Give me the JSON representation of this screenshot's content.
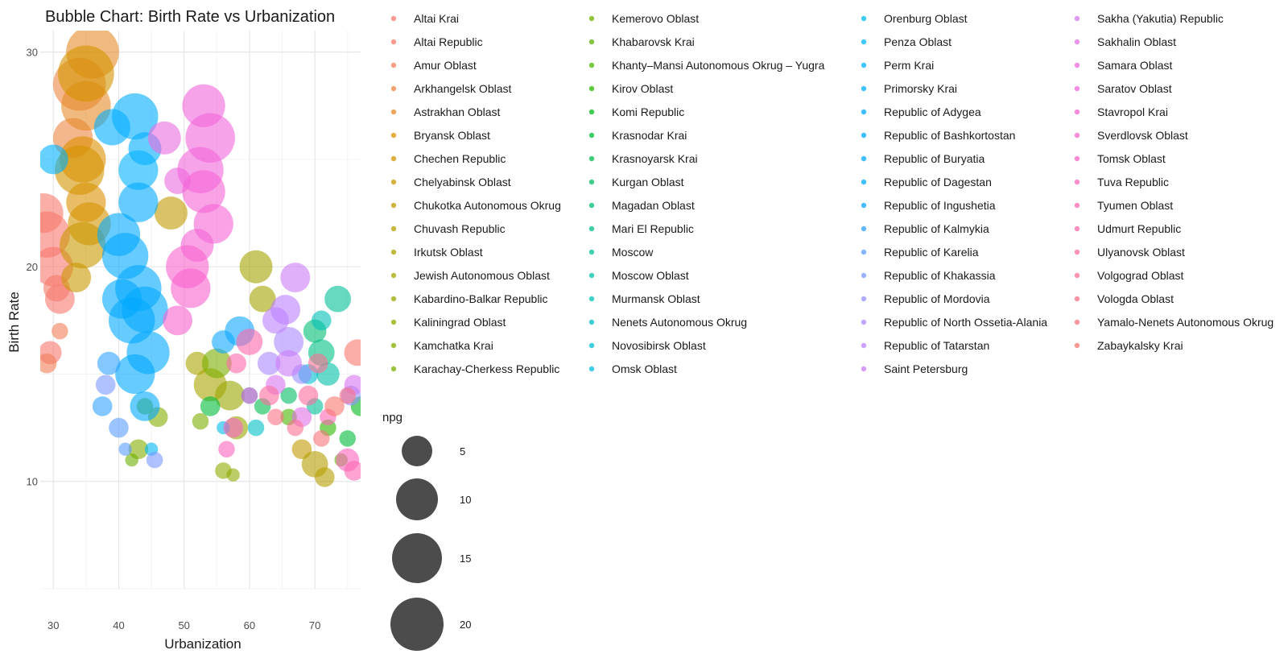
{
  "chart_data": {
    "type": "scatter",
    "title": "Bubble Chart: Birth Rate vs Urbanization",
    "xlabel": "Urbanization",
    "ylabel": "Birth Rate",
    "xlim": [
      28,
      77
    ],
    "ylim": [
      5,
      31
    ],
    "x_ticks": [
      "30",
      "40",
      "50",
      "60",
      "70"
    ],
    "x_tick_values": [
      30,
      40,
      50,
      60,
      70
    ],
    "y_ticks": [
      "10",
      "20",
      "30"
    ],
    "y_tick_values": [
      10,
      20,
      30
    ],
    "grid": true,
    "bubble_opacity": 0.6,
    "legend_placement": "right",
    "size_legend": {
      "title": "npg",
      "entries": [
        {
          "label": "5",
          "value": 5
        },
        {
          "label": "10",
          "value": 10
        },
        {
          "label": "15",
          "value": 15
        },
        {
          "label": "20",
          "value": 20
        }
      ]
    },
    "colors": [
      "#F8766D",
      "#E88526",
      "#C99800",
      "#A3A500",
      "#6BB100",
      "#00BA38",
      "#00BF7D",
      "#00C0AF",
      "#00BCD8",
      "#00B0F6",
      "#619CFF",
      "#B983FF",
      "#E76BF3",
      "#FD61D1",
      "#FF67A4"
    ],
    "series": [
      {
        "name": "Altai Krai",
        "color": "#F8766D",
        "points": [
          [
            29,
            21.5,
            14
          ],
          [
            30,
            20,
            12
          ],
          [
            31,
            18.5,
            9
          ],
          [
            29.5,
            16,
            7
          ]
        ]
      },
      {
        "name": "Altai Republic",
        "color": "#F7796A",
        "points": [
          [
            28.5,
            22.5,
            12
          ],
          [
            30.5,
            19,
            8
          ]
        ]
      },
      {
        "name": "Amur Oblast",
        "color": "#F37F5A",
        "points": [
          [
            29,
            15.5,
            6
          ],
          [
            31,
            17,
            5
          ]
        ]
      },
      {
        "name": "Arkhangelsk Oblast",
        "color": "#EC8640",
        "points": [
          [
            34,
            28.5,
            16
          ],
          [
            33,
            26,
            12
          ]
        ]
      },
      {
        "name": "Astrakhan Oblast",
        "color": "#E68B26",
        "points": [
          [
            36,
            30,
            16
          ],
          [
            35,
            27.5,
            15
          ]
        ]
      },
      {
        "name": "Bryansk Oblast",
        "color": "#DC9000",
        "points": [
          [
            34.5,
            25,
            14
          ],
          [
            35,
            23,
            12
          ]
        ]
      },
      {
        "name": "Chechen Republic",
        "color": "#D39400",
        "points": [
          [
            35,
            29,
            17
          ],
          [
            34,
            24.5,
            15
          ],
          [
            35.5,
            22,
            13
          ]
        ]
      },
      {
        "name": "Chelyabinsk Oblast",
        "color": "#CA9800",
        "points": [
          [
            34.5,
            21,
            14
          ],
          [
            33.5,
            19.5,
            9
          ]
        ]
      },
      {
        "name": "Chukotka Autonomous Okrug",
        "color": "#C09B00",
        "points": [
          [
            48,
            22.5,
            10
          ],
          [
            68,
            11.5,
            6
          ]
        ]
      },
      {
        "name": "Chuvash Republic",
        "color": "#B59F00",
        "points": [
          [
            70,
            10.8,
            8
          ],
          [
            71.5,
            10.2,
            6
          ]
        ]
      },
      {
        "name": "Irkutsk Oblast",
        "color": "#A9A300",
        "points": [
          [
            52,
            15.5,
            7
          ],
          [
            54,
            14.5,
            10
          ]
        ]
      },
      {
        "name": "Jewish Autonomous Oblast",
        "color": "#A3A500",
        "points": [
          [
            61,
            20,
            10
          ],
          [
            62,
            18.5,
            8
          ]
        ]
      },
      {
        "name": "Kabardino-Balkar Republic",
        "color": "#9AA700",
        "points": [
          [
            57,
            14,
            9
          ],
          [
            58,
            12.5,
            7
          ]
        ]
      },
      {
        "name": "Kaliningrad Oblast",
        "color": "#90AA00",
        "points": [
          [
            56,
            10.5,
            5
          ],
          [
            57.5,
            10.3,
            4
          ]
        ]
      },
      {
        "name": "Kamchatka Krai",
        "color": "#84AD00",
        "points": [
          [
            43,
            11.5,
            6
          ],
          [
            46,
            13,
            6
          ]
        ]
      },
      {
        "name": "Karachay-Cherkess Republic",
        "color": "#7AAF00",
        "points": [
          [
            52.5,
            12.8,
            5
          ],
          [
            55,
            15.5,
            9
          ]
        ]
      },
      {
        "name": "Kemerovo Oblast",
        "color": "#6BB100",
        "points": [
          [
            42,
            11,
            4
          ],
          [
            44,
            13.5,
            5
          ]
        ]
      },
      {
        "name": "Khabarovsk Krai",
        "color": "#5BB300",
        "points": [
          [
            74,
            11,
            4
          ]
        ]
      },
      {
        "name": "Khanty–Mansi Autonomous Okrug – Yugra",
        "color": "#47B500",
        "points": [
          [
            66,
            13,
            5
          ]
        ]
      },
      {
        "name": "Kirov Oblast",
        "color": "#2BB700",
        "points": [
          [
            72,
            12.5,
            5
          ]
        ]
      },
      {
        "name": "Komi Republic",
        "color": "#00B919",
        "points": [
          [
            77,
            13.5,
            6
          ]
        ]
      },
      {
        "name": "Krasnodar Krai",
        "color": "#00BA38",
        "points": [
          [
            54,
            13.5,
            6
          ],
          [
            75,
            12,
            5
          ]
        ]
      },
      {
        "name": "Krasnoyarsk Krai",
        "color": "#00BC4E",
        "points": [
          [
            62,
            13.5,
            5
          ]
        ]
      },
      {
        "name": "Kurgan Oblast",
        "color": "#00BD62",
        "points": [
          [
            66,
            14,
            5
          ]
        ]
      },
      {
        "name": "Magadan Oblast",
        "color": "#00BE74",
        "points": [
          [
            70,
            17,
            7
          ]
        ]
      },
      {
        "name": "Mari El Republic",
        "color": "#00BF85",
        "points": [
          [
            71,
            16,
            8
          ]
        ]
      },
      {
        "name": "Moscow",
        "color": "#00C096",
        "points": [
          [
            73.5,
            18.5,
            8
          ],
          [
            70,
            13.5,
            5
          ]
        ]
      },
      {
        "name": "Moscow Oblast",
        "color": "#00C0A6",
        "points": [
          [
            72,
            15,
            7
          ]
        ]
      },
      {
        "name": "Murmansk Oblast",
        "color": "#00C0B5",
        "points": [
          [
            71,
            17.5,
            6
          ]
        ]
      },
      {
        "name": "Nenets Autonomous Okrug",
        "color": "#00C0C4",
        "points": [
          [
            61,
            12.5,
            5
          ]
        ]
      },
      {
        "name": "Novosibirsk Oblast",
        "color": "#00BFD2",
        "points": [
          [
            69,
            15,
            6
          ]
        ]
      },
      {
        "name": "Omsk Oblast",
        "color": "#00BDDF",
        "points": [
          [
            60,
            14,
            5
          ]
        ]
      },
      {
        "name": "Orenburg Oblast",
        "color": "#00BAEB",
        "points": [
          [
            56,
            12.5,
            4
          ]
        ]
      },
      {
        "name": "Penza Oblast",
        "color": "#00B7F5",
        "points": [
          [
            45,
            11.5,
            4
          ]
        ]
      },
      {
        "name": "Perm Krai",
        "color": "#00B2FD",
        "points": [
          [
            30,
            25,
            9
          ],
          [
            43,
            24.5,
            12
          ]
        ]
      },
      {
        "name": "Primorsky Krai",
        "color": "#00ADFF",
        "points": [
          [
            39,
            26.5,
            11
          ],
          [
            42.5,
            27,
            14
          ],
          [
            44,
            25.5,
            10
          ]
        ]
      },
      {
        "name": "Republic of Adygea",
        "color": "#00A9FF",
        "points": [
          [
            43,
            23,
            12
          ],
          [
            40,
            21.5,
            13
          ]
        ]
      },
      {
        "name": "Republic of Bashkortostan",
        "color": "#00A8FF",
        "points": [
          [
            41,
            20.5,
            14
          ],
          [
            43,
            19,
            14
          ],
          [
            44,
            18,
            14
          ]
        ]
      },
      {
        "name": "Republic of Buryatia",
        "color": "#00A8FF",
        "points": [
          [
            42,
            17.5,
            14
          ],
          [
            40.5,
            18.5,
            12
          ],
          [
            44.5,
            16,
            13
          ]
        ]
      },
      {
        "name": "Republic of Dagestan",
        "color": "#00A9FF",
        "points": [
          [
            42.5,
            15,
            12
          ],
          [
            44,
            13.5,
            9
          ]
        ]
      },
      {
        "name": "Republic of Ingushetia",
        "color": "#0EA6FF",
        "points": [
          [
            58.5,
            17,
            9
          ],
          [
            56,
            16.5,
            7
          ]
        ]
      },
      {
        "name": "Republic of Kalmykia",
        "color": "#2EA2FF",
        "points": [
          [
            38.5,
            15.5,
            7
          ],
          [
            37.5,
            13.5,
            6
          ]
        ]
      },
      {
        "name": "Republic of Karelia",
        "color": "#5A9DFF",
        "points": [
          [
            40,
            12.5,
            6
          ],
          [
            41,
            11.5,
            4
          ]
        ]
      },
      {
        "name": "Republic of Khakassia",
        "color": "#7B98FF",
        "points": [
          [
            38,
            14.5,
            6
          ],
          [
            45.5,
            11,
            5
          ]
        ]
      },
      {
        "name": "Republic of Mordovia",
        "color": "#9590FF",
        "points": [
          [
            68,
            15,
            6
          ],
          [
            75.5,
            14,
            6
          ]
        ]
      },
      {
        "name": "Republic of North Ossetia-Alania",
        "color": "#AA88FF",
        "points": [
          [
            63,
            15.5,
            7
          ],
          [
            66,
            16.5,
            9
          ]
        ]
      },
      {
        "name": "Republic of Tatarstan",
        "color": "#BC81FF",
        "points": [
          [
            65.5,
            18,
            9
          ],
          [
            64,
            17.5,
            8
          ]
        ]
      },
      {
        "name": "Saint Petersburg",
        "color": "#CB7BF8",
        "points": [
          [
            67,
            19.5,
            9
          ],
          [
            66,
            15.5,
            8
          ]
        ]
      },
      {
        "name": "Sakha (Yakutia) Republic",
        "color": "#D775EE",
        "points": [
          [
            64,
            14.5,
            6
          ],
          [
            76,
            14.5,
            6
          ]
        ]
      },
      {
        "name": "Sakhalin Oblast",
        "color": "#E16FE5",
        "points": [
          [
            68,
            13,
            6
          ]
        ]
      },
      {
        "name": "Samara Oblast",
        "color": "#EA6AE0",
        "points": [
          [
            47,
            26,
            10
          ],
          [
            49,
            24,
            8
          ]
        ]
      },
      {
        "name": "Saratov Oblast",
        "color": "#F166DB",
        "points": [
          [
            53,
            27.5,
            13
          ],
          [
            54,
            26,
            15
          ],
          [
            52.5,
            24.5,
            14
          ]
        ]
      },
      {
        "name": "Stavropol Krai",
        "color": "#F564D5",
        "points": [
          [
            53,
            23.5,
            13
          ],
          [
            54.5,
            22,
            12
          ],
          [
            52,
            21,
            10
          ]
        ]
      },
      {
        "name": "Sverdlovsk Oblast",
        "color": "#F863CE",
        "points": [
          [
            50.5,
            20,
            13
          ],
          [
            51,
            19,
            12
          ],
          [
            49,
            17.5,
            9
          ]
        ]
      },
      {
        "name": "Tomsk Oblast",
        "color": "#FA63C6",
        "points": [
          [
            57.5,
            12.5,
            6
          ],
          [
            60,
            14,
            5
          ]
        ]
      },
      {
        "name": "Tuva Republic",
        "color": "#FC64BE",
        "points": [
          [
            56.5,
            11.5,
            5
          ],
          [
            75,
            11,
            7
          ]
        ]
      },
      {
        "name": "Tyumen Oblast",
        "color": "#FD66B4",
        "points": [
          [
            72,
            13,
            5
          ],
          [
            76,
            10.5,
            6
          ]
        ]
      },
      {
        "name": "Udmurt Republic",
        "color": "#FE68AA",
        "points": [
          [
            60,
            16.5,
            8
          ],
          [
            58,
            15.5,
            6
          ]
        ]
      },
      {
        "name": "Ulyanovsk Oblast",
        "color": "#FE6C9F",
        "points": [
          [
            63,
            14,
            6
          ],
          [
            69,
            14,
            6
          ]
        ]
      },
      {
        "name": "Volgograd Oblast",
        "color": "#FC6F93",
        "points": [
          [
            70.5,
            15.5,
            6
          ],
          [
            67,
            12.5,
            5
          ]
        ]
      },
      {
        "name": "Vologda Oblast",
        "color": "#FA7286",
        "points": [
          [
            75,
            14,
            5
          ],
          [
            64,
            13,
            5
          ]
        ]
      },
      {
        "name": "Yamalo-Nenets Autonomous Okrug",
        "color": "#F97479",
        "points": [
          [
            71,
            12,
            5
          ]
        ]
      },
      {
        "name": "Zabaykalsky Krai",
        "color": "#F8766D",
        "points": [
          [
            76.5,
            16,
            8
          ],
          [
            73,
            13.5,
            6
          ]
        ]
      }
    ]
  }
}
